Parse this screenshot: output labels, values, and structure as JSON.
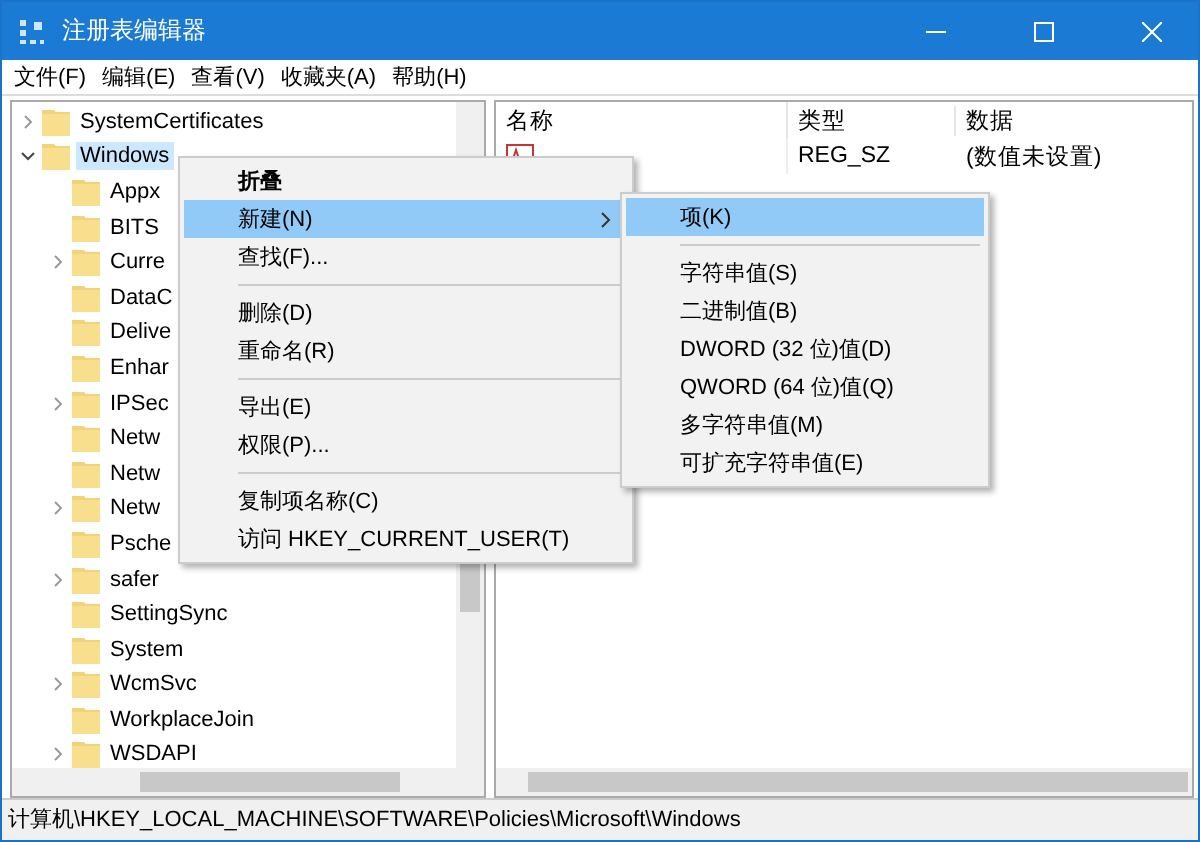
{
  "window": {
    "title": "注册表编辑器"
  },
  "menu_bar": [
    "文件(F)",
    "编辑(E)",
    "查看(V)",
    "收藏夹(A)",
    "帮助(H)"
  ],
  "tree": [
    {
      "label": "SystemCertificates",
      "selected": false,
      "expandable": true,
      "expanded": false
    },
    {
      "label": "Windows",
      "selected": true,
      "expandable": true,
      "expanded": true,
      "children": [
        {
          "label": "Appx",
          "selected": false,
          "expandable": false
        },
        {
          "label": "BITS",
          "selected": false,
          "expandable": false
        },
        {
          "label": "Curre",
          "selected": false,
          "expandable": true,
          "expanded": false
        },
        {
          "label": "DataC",
          "selected": false,
          "expandable": false
        },
        {
          "label": "Delive",
          "selected": false,
          "expandable": false
        },
        {
          "label": "Enhar",
          "selected": false,
          "expandable": false
        },
        {
          "label": "IPSec",
          "selected": false,
          "expandable": true,
          "expanded": false
        },
        {
          "label": "Netw",
          "selected": false,
          "expandable": false
        },
        {
          "label": "Netw",
          "selected": false,
          "expandable": false
        },
        {
          "label": "Netw",
          "selected": false,
          "expandable": true,
          "expanded": false
        },
        {
          "label": "Psche",
          "selected": false,
          "expandable": false
        },
        {
          "label": "safer",
          "selected": false,
          "expandable": true,
          "expanded": false
        },
        {
          "label": "SettingSync",
          "selected": false,
          "expandable": false
        },
        {
          "label": "System",
          "selected": false,
          "expandable": false
        },
        {
          "label": "WcmSvc",
          "selected": false,
          "expandable": true,
          "expanded": false
        },
        {
          "label": "WorkplaceJoin",
          "selected": false,
          "expandable": false
        },
        {
          "label": "WSDAPI",
          "selected": false,
          "expandable": true,
          "expanded": false
        }
      ]
    }
  ],
  "values_table": {
    "columns": [
      "名称",
      "类型",
      "数据"
    ],
    "rows": [
      {
        "type": "REG_SZ",
        "data": "(数值未设置)"
      }
    ]
  },
  "context_menu": [
    {
      "kind": "item",
      "label": "折叠",
      "default": true,
      "selected": false,
      "submenu": false
    },
    {
      "kind": "item",
      "label": "新建(N)",
      "default": false,
      "selected": true,
      "submenu": true
    },
    {
      "kind": "item",
      "label": "查找(F)...",
      "default": false,
      "selected": false,
      "submenu": false
    },
    {
      "kind": "separator"
    },
    {
      "kind": "item",
      "label": "删除(D)",
      "default": false,
      "selected": false,
      "submenu": false
    },
    {
      "kind": "item",
      "label": "重命名(R)",
      "default": false,
      "selected": false,
      "submenu": false
    },
    {
      "kind": "separator"
    },
    {
      "kind": "item",
      "label": "导出(E)",
      "default": false,
      "selected": false,
      "submenu": false
    },
    {
      "kind": "item",
      "label": "权限(P)...",
      "default": false,
      "selected": false,
      "submenu": false
    },
    {
      "kind": "separator"
    },
    {
      "kind": "item",
      "label": "复制项名称(C)",
      "default": false,
      "selected": false,
      "submenu": false
    },
    {
      "kind": "item",
      "label": "访问 HKEY_CURRENT_USER(T)",
      "default": false,
      "selected": false,
      "submenu": false
    }
  ],
  "submenu": [
    {
      "kind": "item",
      "label": "项(K)",
      "selected": true
    },
    {
      "kind": "separator"
    },
    {
      "kind": "item",
      "label": "字符串值(S)",
      "selected": false
    },
    {
      "kind": "item",
      "label": "二进制值(B)",
      "selected": false
    },
    {
      "kind": "item",
      "label": "DWORD (32 位)值(D)",
      "selected": false
    },
    {
      "kind": "item",
      "label": "QWORD (64 位)值(Q)",
      "selected": false
    },
    {
      "kind": "item",
      "label": "多字符串值(M)",
      "selected": false
    },
    {
      "kind": "item",
      "label": "可扩充字符串值(E)",
      "selected": false
    }
  ],
  "status_bar": "计算机\\HKEY_LOCAL_MACHINE\\SOFTWARE\\Policies\\Microsoft\\Windows"
}
